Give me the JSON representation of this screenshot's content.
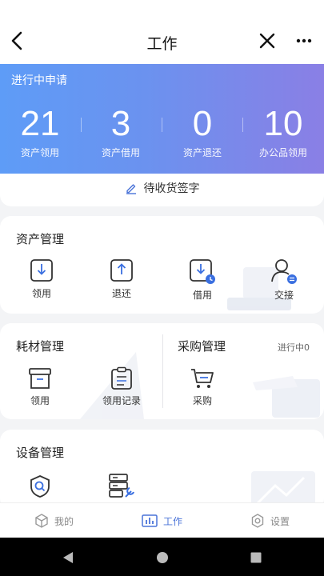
{
  "header": {
    "title": "工作"
  },
  "summary": {
    "heading": "进行中申请",
    "stats": [
      {
        "value": "21",
        "label": "资产领用"
      },
      {
        "value": "3",
        "label": "资产借用"
      },
      {
        "value": "0",
        "label": "资产退还"
      },
      {
        "value": "10",
        "label": "办公品领用"
      }
    ],
    "pending_label": "待收货签字"
  },
  "asset_mgmt": {
    "title": "资产管理",
    "items": [
      "领用",
      "退还",
      "借用",
      "交接"
    ]
  },
  "consumables": {
    "title": "耗材管理",
    "items": [
      "领用",
      "领用记录"
    ]
  },
  "purchase": {
    "title": "采购管理",
    "status": "进行中0",
    "items": [
      "采购"
    ]
  },
  "equipment": {
    "title": "设备管理"
  },
  "tabs": [
    "我的",
    "工作",
    "设置"
  ],
  "colors": {
    "accent": "#4a73d8",
    "gradient_start": "#5e9cf7",
    "gradient_end": "#8a7fe5"
  }
}
